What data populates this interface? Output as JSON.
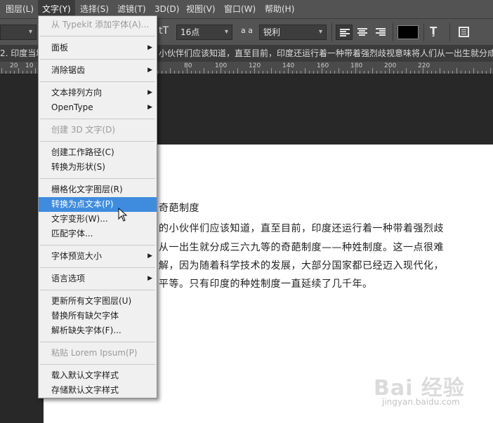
{
  "menubar": {
    "items": [
      {
        "label": "图层(L)"
      },
      {
        "label": "文字(Y)"
      },
      {
        "label": "选择(S)"
      },
      {
        "label": "滤镜(T)"
      },
      {
        "label": "3D(D)"
      },
      {
        "label": "视图(V)"
      },
      {
        "label": "窗口(W)"
      },
      {
        "label": "帮助(H)"
      }
    ]
  },
  "options": {
    "font_size": "16点",
    "aa_label": "a a",
    "antialias": "锐利",
    "text_color": "#000000"
  },
  "notice": {
    "left": "2. 印度当地",
    "right": "小伙伴们应该知道，直至目前，印度还运行着一种带着强烈歧视意味将人们从一出生就分成"
  },
  "ruler": {
    "labels": [
      "20",
      "10",
      "80",
      "100",
      "120",
      "140",
      "160",
      "180",
      "200",
      "220"
    ]
  },
  "document": {
    "lines": [
      "奇葩制度",
      "的小伙伴们应该知道，直至目前，印度还运行着一种带着强烈歧",
      "从一出生就分成三六九等的奇葩制度——种姓制度。这一点很难",
      "解，因为随着科学技术的发展，大部分国家都已经迈入现代化，",
      "平等。只有印度的种姓制度一直延续了几千年。"
    ]
  },
  "dropdown": {
    "items": [
      {
        "label": "从 Typekit 添加字体(A)...",
        "disabled": true
      },
      {
        "label": "面板",
        "submenu": true
      },
      {
        "label": "消除锯齿",
        "submenu": true
      },
      {
        "label": "文本排列方向",
        "submenu": true
      },
      {
        "label": "OpenType",
        "submenu": true
      },
      {
        "label": "创建 3D 文字(D)",
        "disabled": true
      },
      {
        "label": "创建工作路径(C)"
      },
      {
        "label": "转换为形状(S)"
      },
      {
        "label": "栅格化文字图层(R)"
      },
      {
        "label": "转换为点文本(P)",
        "highlighted": true
      },
      {
        "label": "文字变形(W)..."
      },
      {
        "label": "匹配字体..."
      },
      {
        "label": "字体预览大小",
        "submenu": true
      },
      {
        "label": "语言选项",
        "submenu": true
      },
      {
        "label": "更新所有文字图层(U)"
      },
      {
        "label": "替换所有缺欠字体"
      },
      {
        "label": "解析缺失字体(F)..."
      },
      {
        "label": "粘贴 Lorem Ipsum(P)",
        "disabled": true
      },
      {
        "label": "载入默认文字样式"
      },
      {
        "label": "存储默认文字样式"
      }
    ]
  },
  "watermark": {
    "brand": "Bai 经验",
    "url": "jingyan.baidu.com"
  },
  "colors": {
    "highlight": "#3f8cde",
    "menubar": "#535353",
    "canvas": "#282828"
  }
}
